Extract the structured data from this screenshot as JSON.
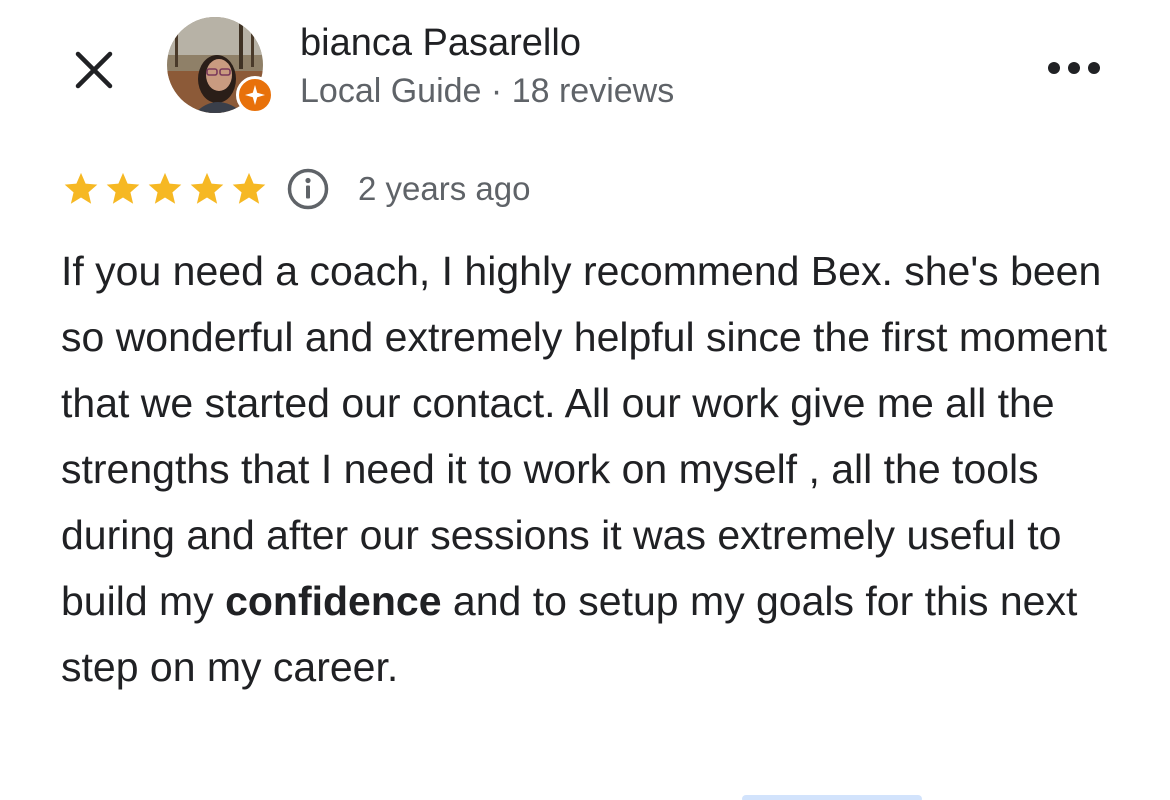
{
  "reviewer": {
    "name": "bianca Pasarello",
    "local_guide_label": "Local Guide",
    "separator": "·",
    "reviews_count": "18 reviews"
  },
  "icons": {
    "close": "close-icon",
    "more": "more-horizontal-icon",
    "info": "info-icon",
    "star": "star-icon",
    "guide_badge": "local-guide-badge-icon"
  },
  "rating": {
    "stars": 5,
    "max_stars": 5
  },
  "timestamp": "2 years ago",
  "review": {
    "part1": "If you need a coach, I highly recommend Bex. she's been so wonderful and extremely helpful since the first moment that we started our contact. All our work give me all the strengths that I need it to work on myself , all the tools during and after our sessions it was extremely useful to build my ",
    "bold": "confidence",
    "part2": " and to setup my goals for this next step on my career."
  },
  "colors": {
    "star": "#f6b823",
    "badge": "#e8710a",
    "text_primary": "#202124",
    "text_secondary": "#5f6368"
  }
}
